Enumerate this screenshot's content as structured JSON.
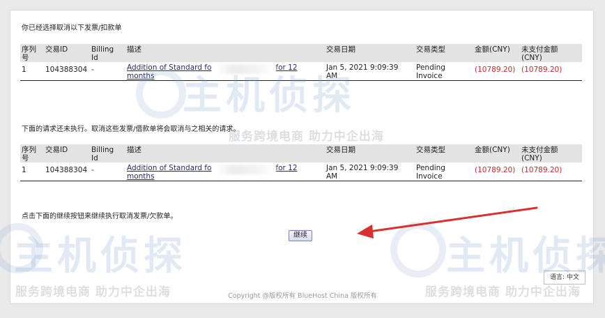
{
  "section1": {
    "title": "你已经选择取消以下发票/扣款单"
  },
  "section2": {
    "title": "下面的请求还未执行。取消这些发票/借款单将会取消与之相关的请求。"
  },
  "section3": {
    "instruction": "点击下面的继续按钮来继续执行取消发票/欠款单。"
  },
  "table": {
    "headers": {
      "seq_line1": "序列",
      "seq_line2": "号",
      "txn_id": "交易ID",
      "billing_line1": "Billing",
      "billing_line2": "Id",
      "desc": "描述",
      "date": "交易日期",
      "type": "交易类型",
      "amount": "金额(CNY)",
      "unpaid_line1": "未支付金额",
      "unpaid_line2": "(CNY)"
    },
    "row": {
      "seq": "1",
      "txn_id": "104388304",
      "billing_id": "-",
      "desc_part1": "Addition of Standard fo",
      "desc_part2": "for 12",
      "desc_line2": "months",
      "date_line1": "Jan 5, 2021 9:09:39",
      "date_line2": "AM",
      "type_line1": "Pending",
      "type_line2": "Invoice",
      "amount": "(10789.20)",
      "unpaid": "(10789.20)"
    }
  },
  "buttons": {
    "continue_label": "继续"
  },
  "language": {
    "label": "语言: 中文"
  },
  "footer": {
    "copyright": "Copyright @版权所有 BlueHost China 版权所有"
  },
  "watermark": {
    "brand": "主机侦探",
    "slogan": "服务跨境电商 助力中企出海"
  },
  "colors": {
    "negative": "#c62828",
    "header_bg": "#e3e3e3",
    "arrow": "#d93030",
    "watermark": "#78a0cd"
  }
}
